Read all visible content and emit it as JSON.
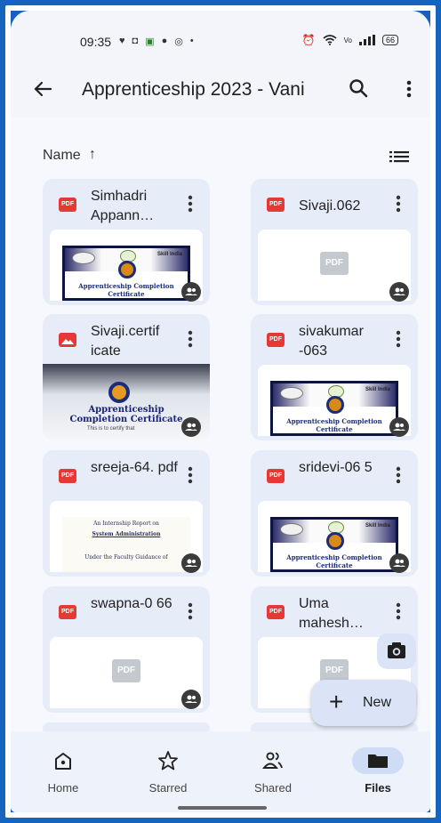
{
  "status": {
    "time": "09:35",
    "left_icons": [
      "♥",
      "◘",
      "▣",
      "●",
      "◎",
      "•"
    ],
    "right_icons": [
      "⏰",
      "wifi",
      "Vo",
      "signal"
    ],
    "battery": "66"
  },
  "toolbar": {
    "title": "Apprenticeship 2023 - Vani"
  },
  "sort": {
    "label": "Name",
    "direction_symbol": "↑"
  },
  "files": [
    {
      "name": "Simhadri Appann…",
      "type": "pdf",
      "thumb": "certificate",
      "shared": true
    },
    {
      "name": "Sivaji.062",
      "type": "pdf",
      "thumb": "placeholder",
      "shared": true
    },
    {
      "name": "Sivaji.certif icate",
      "type": "image",
      "thumb": "photo",
      "shared": true
    },
    {
      "name": "sivakumar -063",
      "type": "pdf",
      "thumb": "certificate",
      "shared": true
    },
    {
      "name": "sreeja-64. pdf",
      "type": "pdf",
      "thumb": "report",
      "shared": true
    },
    {
      "name": "sridevi-06 5",
      "type": "pdf",
      "thumb": "certificate",
      "shared": true
    },
    {
      "name": "swapna-0 66",
      "type": "pdf",
      "thumb": "placeholder",
      "shared": true
    },
    {
      "name": "Uma mahesh…",
      "type": "pdf",
      "thumb": "placeholder",
      "shared": false
    }
  ],
  "thumb_text": {
    "pdf_placeholder": "PDF",
    "cert_title": "Apprenticeship Completion Certificate",
    "cert_skill": "Skill India",
    "photo_title_1": "Apprenticeship",
    "photo_title_2": "Completion Certificate",
    "photo_sub": "This is to certify that",
    "report_l1": "An Internship Report on",
    "report_l2": "System Administration",
    "report_l3": "Under the Faculty Guidance of"
  },
  "fab": {
    "new_label": "New"
  },
  "nav": [
    {
      "label": "Home",
      "icon": "home-icon",
      "active": false
    },
    {
      "label": "Starred",
      "icon": "star-icon",
      "active": false
    },
    {
      "label": "Shared",
      "icon": "shared-icon",
      "active": false
    },
    {
      "label": "Files",
      "icon": "folder-icon",
      "active": true
    }
  ],
  "colors": {
    "background": "#f6f8fd",
    "card": "#e6ecf8",
    "pdf_red": "#e53935",
    "accent": "#cfdcf6",
    "border": "#1565c0"
  }
}
